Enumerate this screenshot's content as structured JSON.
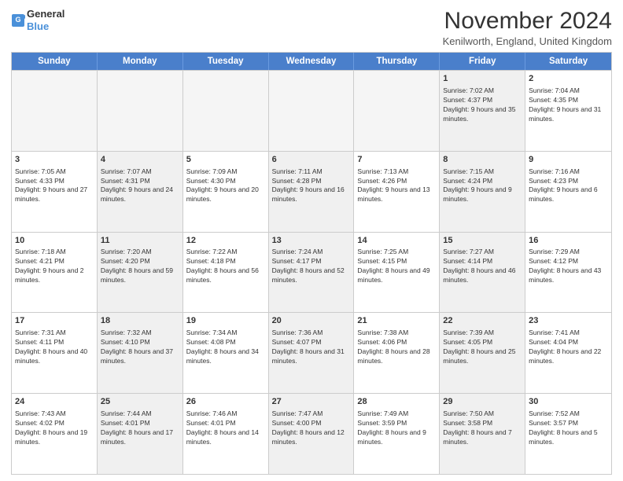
{
  "logo": {
    "line1": "General",
    "line2": "Blue"
  },
  "title": "November 2024",
  "location": "Kenilworth, England, United Kingdom",
  "days_of_week": [
    "Sunday",
    "Monday",
    "Tuesday",
    "Wednesday",
    "Thursday",
    "Friday",
    "Saturday"
  ],
  "weeks": [
    [
      {
        "day": "",
        "info": "",
        "empty": true
      },
      {
        "day": "",
        "info": "",
        "empty": true
      },
      {
        "day": "",
        "info": "",
        "empty": true
      },
      {
        "day": "",
        "info": "",
        "empty": true
      },
      {
        "day": "",
        "info": "",
        "empty": true
      },
      {
        "day": "1",
        "info": "Sunrise: 7:02 AM\nSunset: 4:37 PM\nDaylight: 9 hours and 35 minutes.",
        "empty": false
      },
      {
        "day": "2",
        "info": "Sunrise: 7:04 AM\nSunset: 4:35 PM\nDaylight: 9 hours and 31 minutes.",
        "empty": false
      }
    ],
    [
      {
        "day": "3",
        "info": "Sunrise: 7:05 AM\nSunset: 4:33 PM\nDaylight: 9 hours and 27 minutes.",
        "empty": false
      },
      {
        "day": "4",
        "info": "Sunrise: 7:07 AM\nSunset: 4:31 PM\nDaylight: 9 hours and 24 minutes.",
        "empty": false
      },
      {
        "day": "5",
        "info": "Sunrise: 7:09 AM\nSunset: 4:30 PM\nDaylight: 9 hours and 20 minutes.",
        "empty": false
      },
      {
        "day": "6",
        "info": "Sunrise: 7:11 AM\nSunset: 4:28 PM\nDaylight: 9 hours and 16 minutes.",
        "empty": false
      },
      {
        "day": "7",
        "info": "Sunrise: 7:13 AM\nSunset: 4:26 PM\nDaylight: 9 hours and 13 minutes.",
        "empty": false
      },
      {
        "day": "8",
        "info": "Sunrise: 7:15 AM\nSunset: 4:24 PM\nDaylight: 9 hours and 9 minutes.",
        "empty": false
      },
      {
        "day": "9",
        "info": "Sunrise: 7:16 AM\nSunset: 4:23 PM\nDaylight: 9 hours and 6 minutes.",
        "empty": false
      }
    ],
    [
      {
        "day": "10",
        "info": "Sunrise: 7:18 AM\nSunset: 4:21 PM\nDaylight: 9 hours and 2 minutes.",
        "empty": false
      },
      {
        "day": "11",
        "info": "Sunrise: 7:20 AM\nSunset: 4:20 PM\nDaylight: 8 hours and 59 minutes.",
        "empty": false
      },
      {
        "day": "12",
        "info": "Sunrise: 7:22 AM\nSunset: 4:18 PM\nDaylight: 8 hours and 56 minutes.",
        "empty": false
      },
      {
        "day": "13",
        "info": "Sunrise: 7:24 AM\nSunset: 4:17 PM\nDaylight: 8 hours and 52 minutes.",
        "empty": false
      },
      {
        "day": "14",
        "info": "Sunrise: 7:25 AM\nSunset: 4:15 PM\nDaylight: 8 hours and 49 minutes.",
        "empty": false
      },
      {
        "day": "15",
        "info": "Sunrise: 7:27 AM\nSunset: 4:14 PM\nDaylight: 8 hours and 46 minutes.",
        "empty": false
      },
      {
        "day": "16",
        "info": "Sunrise: 7:29 AM\nSunset: 4:12 PM\nDaylight: 8 hours and 43 minutes.",
        "empty": false
      }
    ],
    [
      {
        "day": "17",
        "info": "Sunrise: 7:31 AM\nSunset: 4:11 PM\nDaylight: 8 hours and 40 minutes.",
        "empty": false
      },
      {
        "day": "18",
        "info": "Sunrise: 7:32 AM\nSunset: 4:10 PM\nDaylight: 8 hours and 37 minutes.",
        "empty": false
      },
      {
        "day": "19",
        "info": "Sunrise: 7:34 AM\nSunset: 4:08 PM\nDaylight: 8 hours and 34 minutes.",
        "empty": false
      },
      {
        "day": "20",
        "info": "Sunrise: 7:36 AM\nSunset: 4:07 PM\nDaylight: 8 hours and 31 minutes.",
        "empty": false
      },
      {
        "day": "21",
        "info": "Sunrise: 7:38 AM\nSunset: 4:06 PM\nDaylight: 8 hours and 28 minutes.",
        "empty": false
      },
      {
        "day": "22",
        "info": "Sunrise: 7:39 AM\nSunset: 4:05 PM\nDaylight: 8 hours and 25 minutes.",
        "empty": false
      },
      {
        "day": "23",
        "info": "Sunrise: 7:41 AM\nSunset: 4:04 PM\nDaylight: 8 hours and 22 minutes.",
        "empty": false
      }
    ],
    [
      {
        "day": "24",
        "info": "Sunrise: 7:43 AM\nSunset: 4:02 PM\nDaylight: 8 hours and 19 minutes.",
        "empty": false
      },
      {
        "day": "25",
        "info": "Sunrise: 7:44 AM\nSunset: 4:01 PM\nDaylight: 8 hours and 17 minutes.",
        "empty": false
      },
      {
        "day": "26",
        "info": "Sunrise: 7:46 AM\nSunset: 4:01 PM\nDaylight: 8 hours and 14 minutes.",
        "empty": false
      },
      {
        "day": "27",
        "info": "Sunrise: 7:47 AM\nSunset: 4:00 PM\nDaylight: 8 hours and 12 minutes.",
        "empty": false
      },
      {
        "day": "28",
        "info": "Sunrise: 7:49 AM\nSunset: 3:59 PM\nDaylight: 8 hours and 9 minutes.",
        "empty": false
      },
      {
        "day": "29",
        "info": "Sunrise: 7:50 AM\nSunset: 3:58 PM\nDaylight: 8 hours and 7 minutes.",
        "empty": false
      },
      {
        "day": "30",
        "info": "Sunrise: 7:52 AM\nSunset: 3:57 PM\nDaylight: 8 hours and 5 minutes.",
        "empty": false
      }
    ]
  ]
}
